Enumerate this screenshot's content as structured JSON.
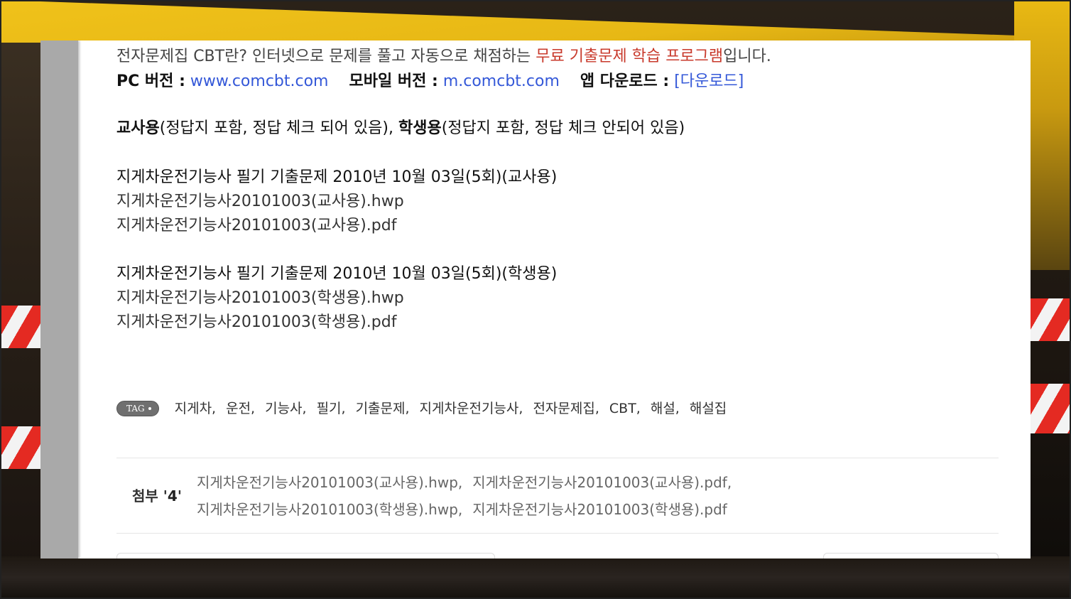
{
  "intro": {
    "prefix": "전자문제집 CBT란? 인터넷으로 문제를 풀고 자동으로 채점하는 ",
    "highlight": "무료 기출문제 학습 프로그램",
    "suffix": "입니다."
  },
  "versions": {
    "pc_label": "PC 버전 :",
    "pc_link": "www.comcbt.com",
    "mobile_label": "모바일 버전 :",
    "mobile_link": "m.comcbt.com",
    "app_label": "앱 다운로드 :",
    "app_link": "[다운로드]"
  },
  "usage": {
    "teacher": "교사용",
    "teacher_desc": "(정답지 포함, 정답 체크 되어 있음), ",
    "student": "학생용",
    "student_desc": "(정답지 포함, 정답 체크 안되어 있음)"
  },
  "groups": [
    {
      "title": "지게차운전기능사 필기 기출문제 2010년 10월 03일(5회)(교사용)",
      "files": [
        "지게차운전기능사20101003(교사용).hwp",
        "지게차운전기능사20101003(교사용).pdf"
      ]
    },
    {
      "title": "지게차운전기능사 필기 기출문제 2010년 10월 03일(5회)(학생용)",
      "files": [
        "지게차운전기능사20101003(학생용).hwp",
        "지게차운전기능사20101003(학생용).pdf"
      ]
    }
  ],
  "tags": {
    "badge": "TAG",
    "items": [
      "지게차,",
      "운전,",
      "기능사,",
      "필기,",
      "기출문제,",
      "지게차운전기능사,",
      "전자문제집,",
      "CBT,",
      "해설,",
      "해설집"
    ]
  },
  "attachments": {
    "label": "첨부 '",
    "count": "4",
    "label_end": "'",
    "rows": [
      [
        "지게차운전기능사20101003(교사용).hwp,",
        "지게차운전기능사20101003(교사용).pdf,"
      ],
      [
        "지게차운전기능사20101003(학생용).hwp,",
        "지게차운전기능사20101003(학생용).pdf"
      ]
    ]
  },
  "colors": {
    "highlight_red": "#c8392b",
    "link_blue": "#3458d8",
    "rail_gray": "#a9a9a9"
  }
}
